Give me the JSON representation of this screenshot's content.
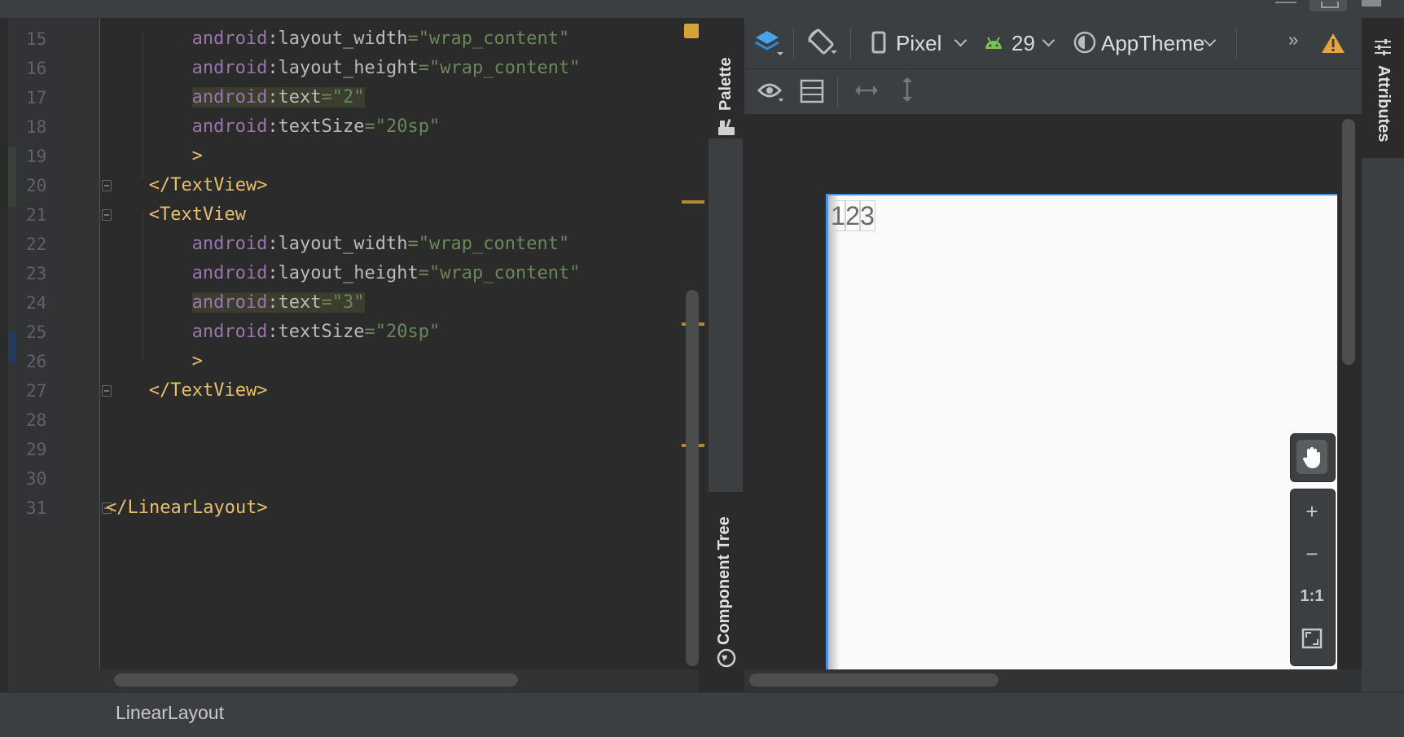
{
  "editor": {
    "lines": [
      {
        "num": "15",
        "indent": 2,
        "kind": "attr",
        "ns": "android",
        "attr": "layout_width",
        "val": "\"wrap_content\"",
        "hl": false
      },
      {
        "num": "16",
        "indent": 2,
        "kind": "attr",
        "ns": "android",
        "attr": "layout_height",
        "val": "\"wrap_content\"",
        "hl": false
      },
      {
        "num": "17",
        "indent": 2,
        "kind": "attr",
        "ns": "android",
        "attr": "text",
        "val": "\"2\"",
        "hl": true
      },
      {
        "num": "18",
        "indent": 2,
        "kind": "attr",
        "ns": "android",
        "attr": "textSize",
        "val": "\"20sp\"",
        "hl": false
      },
      {
        "num": "19",
        "indent": 2,
        "kind": "tag",
        "text": ">",
        "fold": false
      },
      {
        "num": "20",
        "indent": 1,
        "kind": "tag",
        "text": "</TextView>",
        "fold": true
      },
      {
        "num": "21",
        "indent": 1,
        "kind": "tag",
        "text": "<TextView",
        "fold": true
      },
      {
        "num": "22",
        "indent": 2,
        "kind": "attr",
        "ns": "android",
        "attr": "layout_width",
        "val": "\"wrap_content\"",
        "hl": false
      },
      {
        "num": "23",
        "indent": 2,
        "kind": "attr",
        "ns": "android",
        "attr": "layout_height",
        "val": "\"wrap_content\"",
        "hl": false
      },
      {
        "num": "24",
        "indent": 2,
        "kind": "attr",
        "ns": "android",
        "attr": "text",
        "val": "\"3\"",
        "hl": true
      },
      {
        "num": "25",
        "indent": 2,
        "kind": "attr",
        "ns": "android",
        "attr": "textSize",
        "val": "\"20sp\"",
        "hl": false
      },
      {
        "num": "26",
        "indent": 2,
        "kind": "tag",
        "text": ">",
        "fold": false
      },
      {
        "num": "27",
        "indent": 1,
        "kind": "tag",
        "text": "</TextView>",
        "fold": true
      },
      {
        "num": "28",
        "indent": 0,
        "kind": "blank"
      },
      {
        "num": "29",
        "indent": 0,
        "kind": "blank"
      },
      {
        "num": "30",
        "indent": 0,
        "kind": "blank"
      },
      {
        "num": "31",
        "indent": 0,
        "kind": "tag",
        "text": "</LinearLayout>",
        "fold": true
      }
    ]
  },
  "side_panels": {
    "palette": "Palette",
    "component_tree": "Component Tree",
    "attributes": "Attributes"
  },
  "design_toolbar": {
    "device": "Pixel",
    "api_level": "29",
    "theme": "AppTheme",
    "overflow": "»"
  },
  "preview": {
    "text_views": [
      "1",
      "2",
      "3"
    ]
  },
  "zoom_controls": {
    "zoom_in": "+",
    "zoom_out": "−",
    "actual_size": "1:1"
  },
  "status_bar": {
    "breadcrumb": "LinearLayout"
  },
  "colors": {
    "accent_blue": "#4a90e2",
    "warning": "#e8a33b",
    "android_green": "#78c257"
  }
}
